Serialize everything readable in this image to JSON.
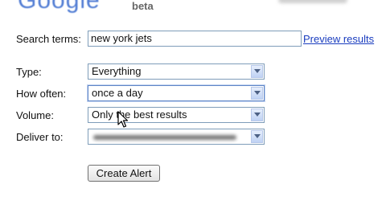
{
  "header": {
    "logo_text": "Google",
    "beta_label": "beta"
  },
  "form": {
    "search_label": "Search terms:",
    "search_value": "new york jets",
    "preview_link": "Preview results",
    "type_label": "Type:",
    "type_value": "Everything",
    "often_label": "How often:",
    "often_value": "once a day",
    "volume_label": "Volume:",
    "volume_value": "Only the best results",
    "deliver_label": "Deliver to:",
    "deliver_value": "",
    "create_button": "Create Alert"
  },
  "colors": {
    "link": "#1a3dbf",
    "field_border": "#7f9db9"
  }
}
